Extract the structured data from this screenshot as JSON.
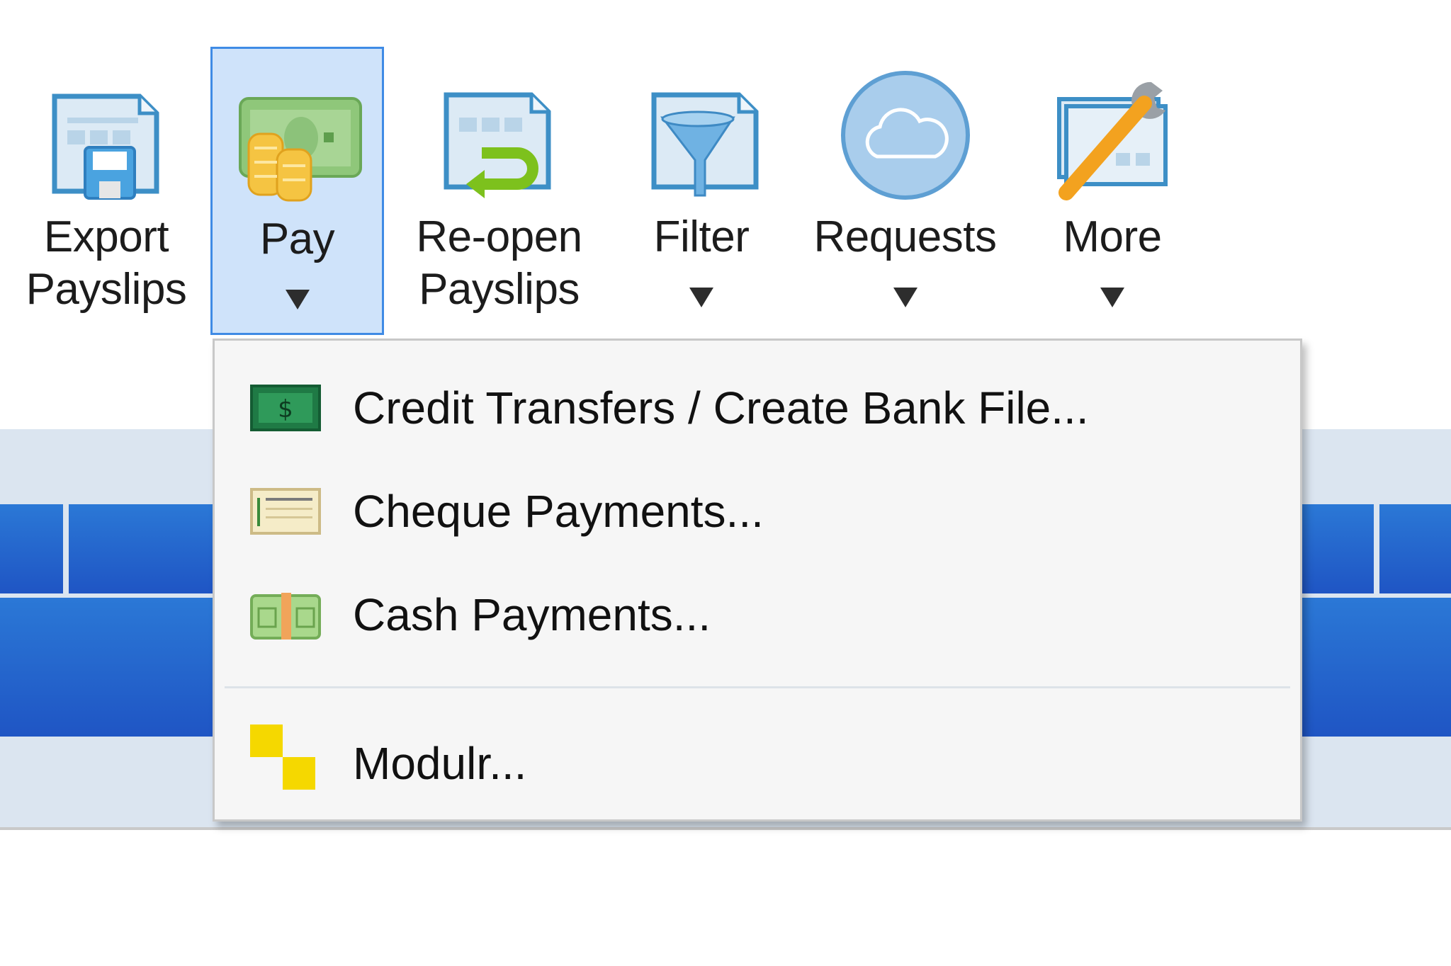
{
  "ribbon": {
    "buttons": [
      {
        "label": "Export Payslips",
        "line1": "Export",
        "line2": "Payslips",
        "icon": "export-payslips-icon",
        "dropdown": false
      },
      {
        "label": "Pay",
        "line1": "Pay",
        "line2": "",
        "icon": "pay-money-icon",
        "dropdown": true,
        "active": true
      },
      {
        "label": "Re-open Payslips",
        "line1": "Re-open",
        "line2": "Payslips",
        "icon": "reopen-payslips-icon",
        "dropdown": false
      },
      {
        "label": "Filter",
        "line1": "Filter",
        "line2": "",
        "icon": "filter-funnel-icon",
        "dropdown": true
      },
      {
        "label": "Requests",
        "line1": "Requests",
        "line2": "",
        "icon": "cloud-requests-icon",
        "dropdown": true
      },
      {
        "label": "More",
        "line1": "More",
        "line2": "",
        "icon": "wrench-tools-icon",
        "dropdown": true
      }
    ]
  },
  "pay_menu": {
    "items": [
      {
        "label": "Credit Transfers / Create Bank File...",
        "icon": "bank-note-icon"
      },
      {
        "label": "Cheque Payments...",
        "icon": "cheque-icon"
      },
      {
        "label": "Cash Payments...",
        "icon": "cash-bundle-icon"
      },
      {
        "label": "Modulr...",
        "icon": "modulr-logo-icon"
      }
    ]
  },
  "colors": {
    "accent": "#3f8be5",
    "active_bg": "#cfe3fa",
    "bar_blue": "#2366cc",
    "band_bg": "#dbe5f0",
    "modulr_yellow": "#f5d800"
  }
}
